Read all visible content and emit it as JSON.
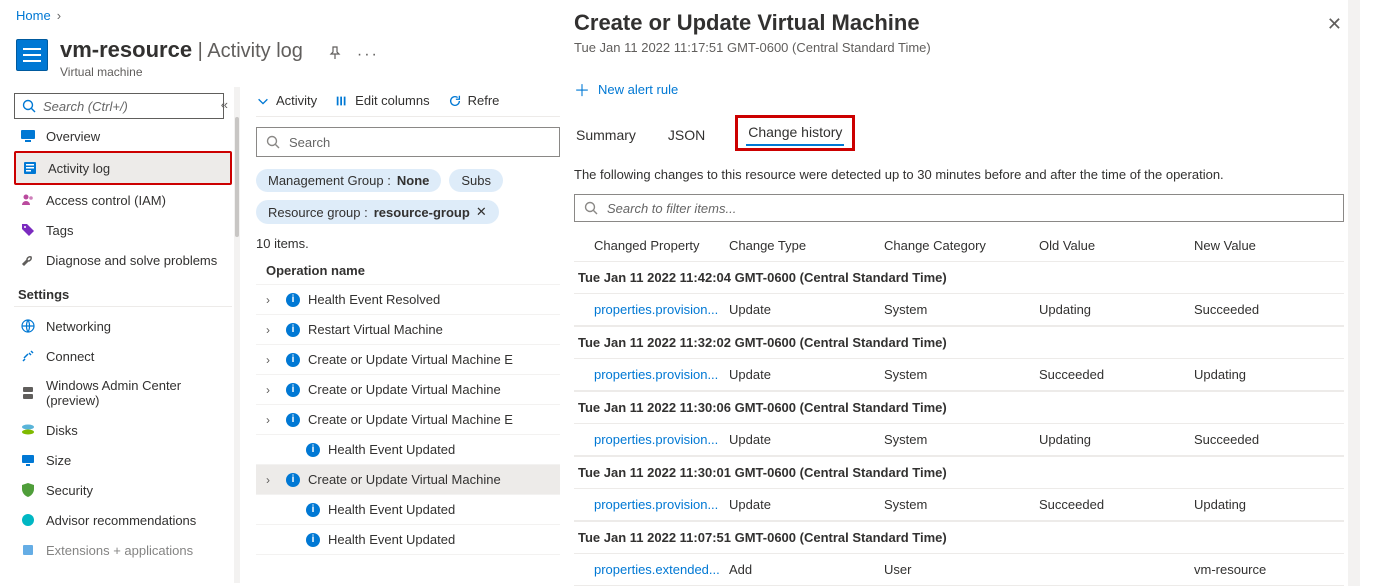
{
  "breadcrumb": {
    "home": "Home"
  },
  "resource": {
    "name": "vm-resource",
    "separator": " | ",
    "page": "Activity log",
    "type": "Virtual machine"
  },
  "sidebar_search": {
    "placeholder": "Search (Ctrl+/)"
  },
  "nav": {
    "overview": "Overview",
    "activity_log": "Activity log",
    "access": "Access control (IAM)",
    "tags": "Tags",
    "diagnose": "Diagnose and solve problems",
    "settings_heading": "Settings",
    "networking": "Networking",
    "connect": "Connect",
    "wac": "Windows Admin Center (preview)",
    "disks": "Disks",
    "size": "Size",
    "security": "Security",
    "advisor": "Advisor recommendations",
    "extensions": "Extensions + applications"
  },
  "toolbar": {
    "activity": "Activity",
    "edit_columns": "Edit columns",
    "refresh": "Refre"
  },
  "filter_search_placeholder": "Search",
  "pills": {
    "mg_label": "Management Group : ",
    "mg_value": "None",
    "subs": "Subs",
    "rg_label": "Resource group : ",
    "rg_value": "resource-group"
  },
  "item_count": "10 items.",
  "grid": {
    "col_operation": "Operation name",
    "rows": [
      "Health Event Resolved",
      "Restart Virtual Machine",
      "Create or Update Virtual Machine E",
      "Create or Update Virtual Machine",
      "Create or Update Virtual Machine E",
      "Health Event Updated",
      "Create or Update Virtual Machine",
      "Health Event Updated",
      "Health Event Updated"
    ]
  },
  "blade": {
    "title": "Create or Update Virtual Machine",
    "subtitle": "Tue Jan 11 2022 11:17:51 GMT-0600 (Central Standard Time)",
    "new_alert": "New alert rule",
    "tabs": {
      "summary": "Summary",
      "json": "JSON",
      "change_history": "Change history"
    },
    "desc": "The following changes to this resource were detected up to 30 minutes before and after the time of the operation.",
    "filter_placeholder": "Search to filter items...",
    "columns": {
      "prop": "Changed Property",
      "type": "Change Type",
      "cat": "Change Category",
      "old": "Old Value",
      "new": "New Value"
    },
    "groups": [
      {
        "ts": "Tue Jan 11 2022 11:42:04 GMT-0600 (Central Standard Time)",
        "rows": [
          {
            "prop": "properties.provision...",
            "type": "Update",
            "cat": "System",
            "old": "Updating",
            "new": "Succeeded"
          }
        ]
      },
      {
        "ts": "Tue Jan 11 2022 11:32:02 GMT-0600 (Central Standard Time)",
        "rows": [
          {
            "prop": "properties.provision...",
            "type": "Update",
            "cat": "System",
            "old": "Succeeded",
            "new": "Updating"
          }
        ]
      },
      {
        "ts": "Tue Jan 11 2022 11:30:06 GMT-0600 (Central Standard Time)",
        "rows": [
          {
            "prop": "properties.provision...",
            "type": "Update",
            "cat": "System",
            "old": "Updating",
            "new": "Succeeded"
          }
        ]
      },
      {
        "ts": "Tue Jan 11 2022 11:30:01 GMT-0600 (Central Standard Time)",
        "rows": [
          {
            "prop": "properties.provision...",
            "type": "Update",
            "cat": "System",
            "old": "Succeeded",
            "new": "Updating"
          }
        ]
      },
      {
        "ts": "Tue Jan 11 2022 11:07:51 GMT-0600 (Central Standard Time)",
        "rows": [
          {
            "prop": "properties.extended...",
            "type": "Add",
            "cat": "User",
            "old": "",
            "new": "vm-resource"
          }
        ]
      }
    ]
  }
}
